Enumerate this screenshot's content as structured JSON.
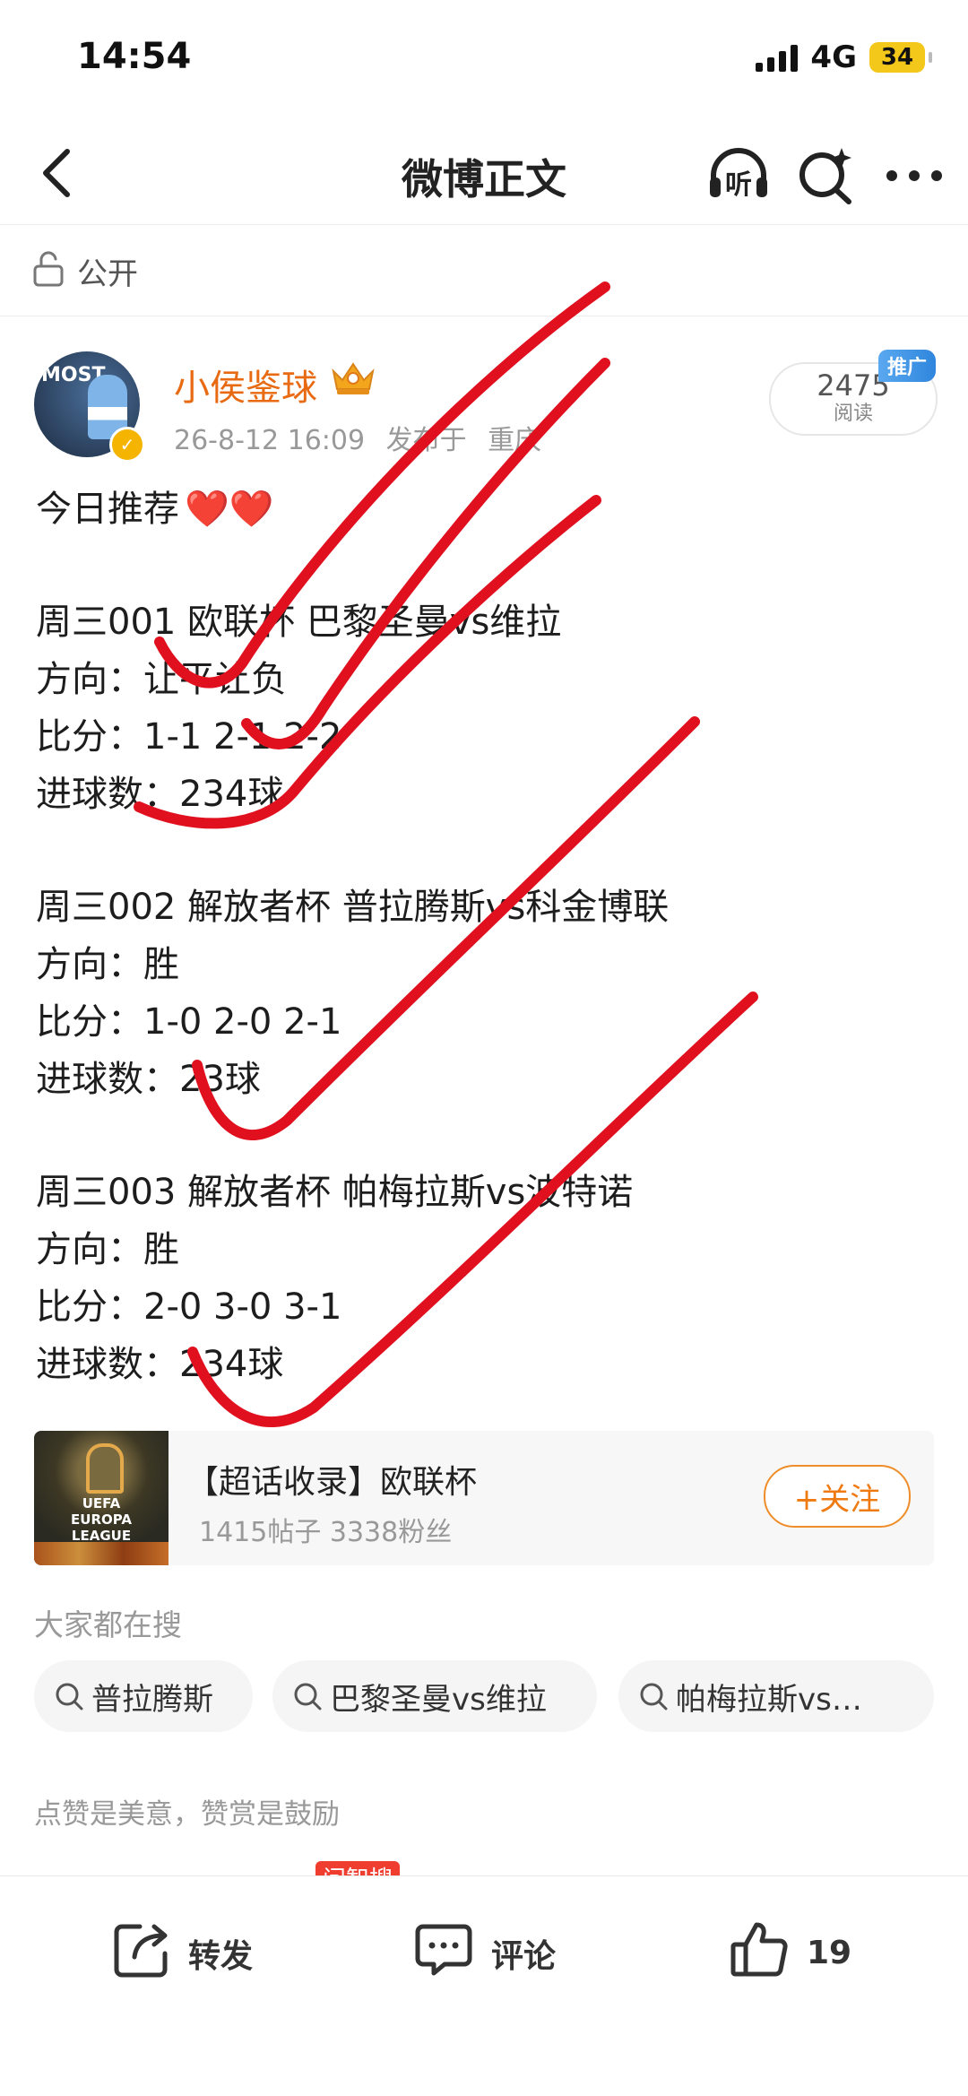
{
  "status_bar": {
    "time": "14:54",
    "network": "4G",
    "battery": "34"
  },
  "nav": {
    "title": "微博正文",
    "icons": [
      "back-icon",
      "listen-icon",
      "search-sparkle-icon",
      "more-icon"
    ],
    "listen_label": "听"
  },
  "visibility": {
    "icon": "lock-icon",
    "label": "公开"
  },
  "author": {
    "avatar_text": "MOST",
    "name": "小侯鉴球",
    "badge_icon": "crown-icon",
    "verified_icon": "v-badge-icon",
    "date": "26-8-12 16:09",
    "location_prefix": "发布于",
    "location": "重庆"
  },
  "reads": {
    "count": "2475",
    "label": "阅读",
    "promo": "推广"
  },
  "post": {
    "intro": "今日推荐",
    "hearts": "❤️❤️",
    "matches": [
      {
        "title": "周三001 欧联杯 巴黎圣曼vs维拉",
        "direction": "方向：让平让负",
        "score": "比分：1-1  2-1  2-2",
        "goals": "进球数：234球"
      },
      {
        "title": "周三002 解放者杯 普拉腾斯vs科金博联",
        "direction": "方向：胜",
        "score": "比分：1-0  2-0  2-1",
        "goals": "进球数：23球"
      },
      {
        "title": "周三003 解放者杯 帕梅拉斯vs波特诺",
        "direction": "方向：胜",
        "score": "比分：2-0  3-0  3-1",
        "goals": "进球数：234球"
      }
    ]
  },
  "topic": {
    "logo_line1": "UEFA",
    "logo_line2": "EUROPA",
    "logo_line3": "LEAGUE",
    "title": "【超话收录】欧联杯",
    "stats": "1415帖子 3338粉丝",
    "follow": "+关注"
  },
  "search": {
    "heading": "大家都在搜",
    "chips": [
      "普拉腾斯",
      "巴黎圣曼vs维拉",
      "帕梅拉斯vs…"
    ]
  },
  "reward_text": "点赞是美意，赞赏是鼓励",
  "peek_badge": "问智搜",
  "toolbar": {
    "repost": "转发",
    "comment": "评论",
    "like_count": "19"
  },
  "colors": {
    "accent": "#e86a12",
    "scribble": "#e0101e",
    "promo": "#3a8fe0"
  }
}
